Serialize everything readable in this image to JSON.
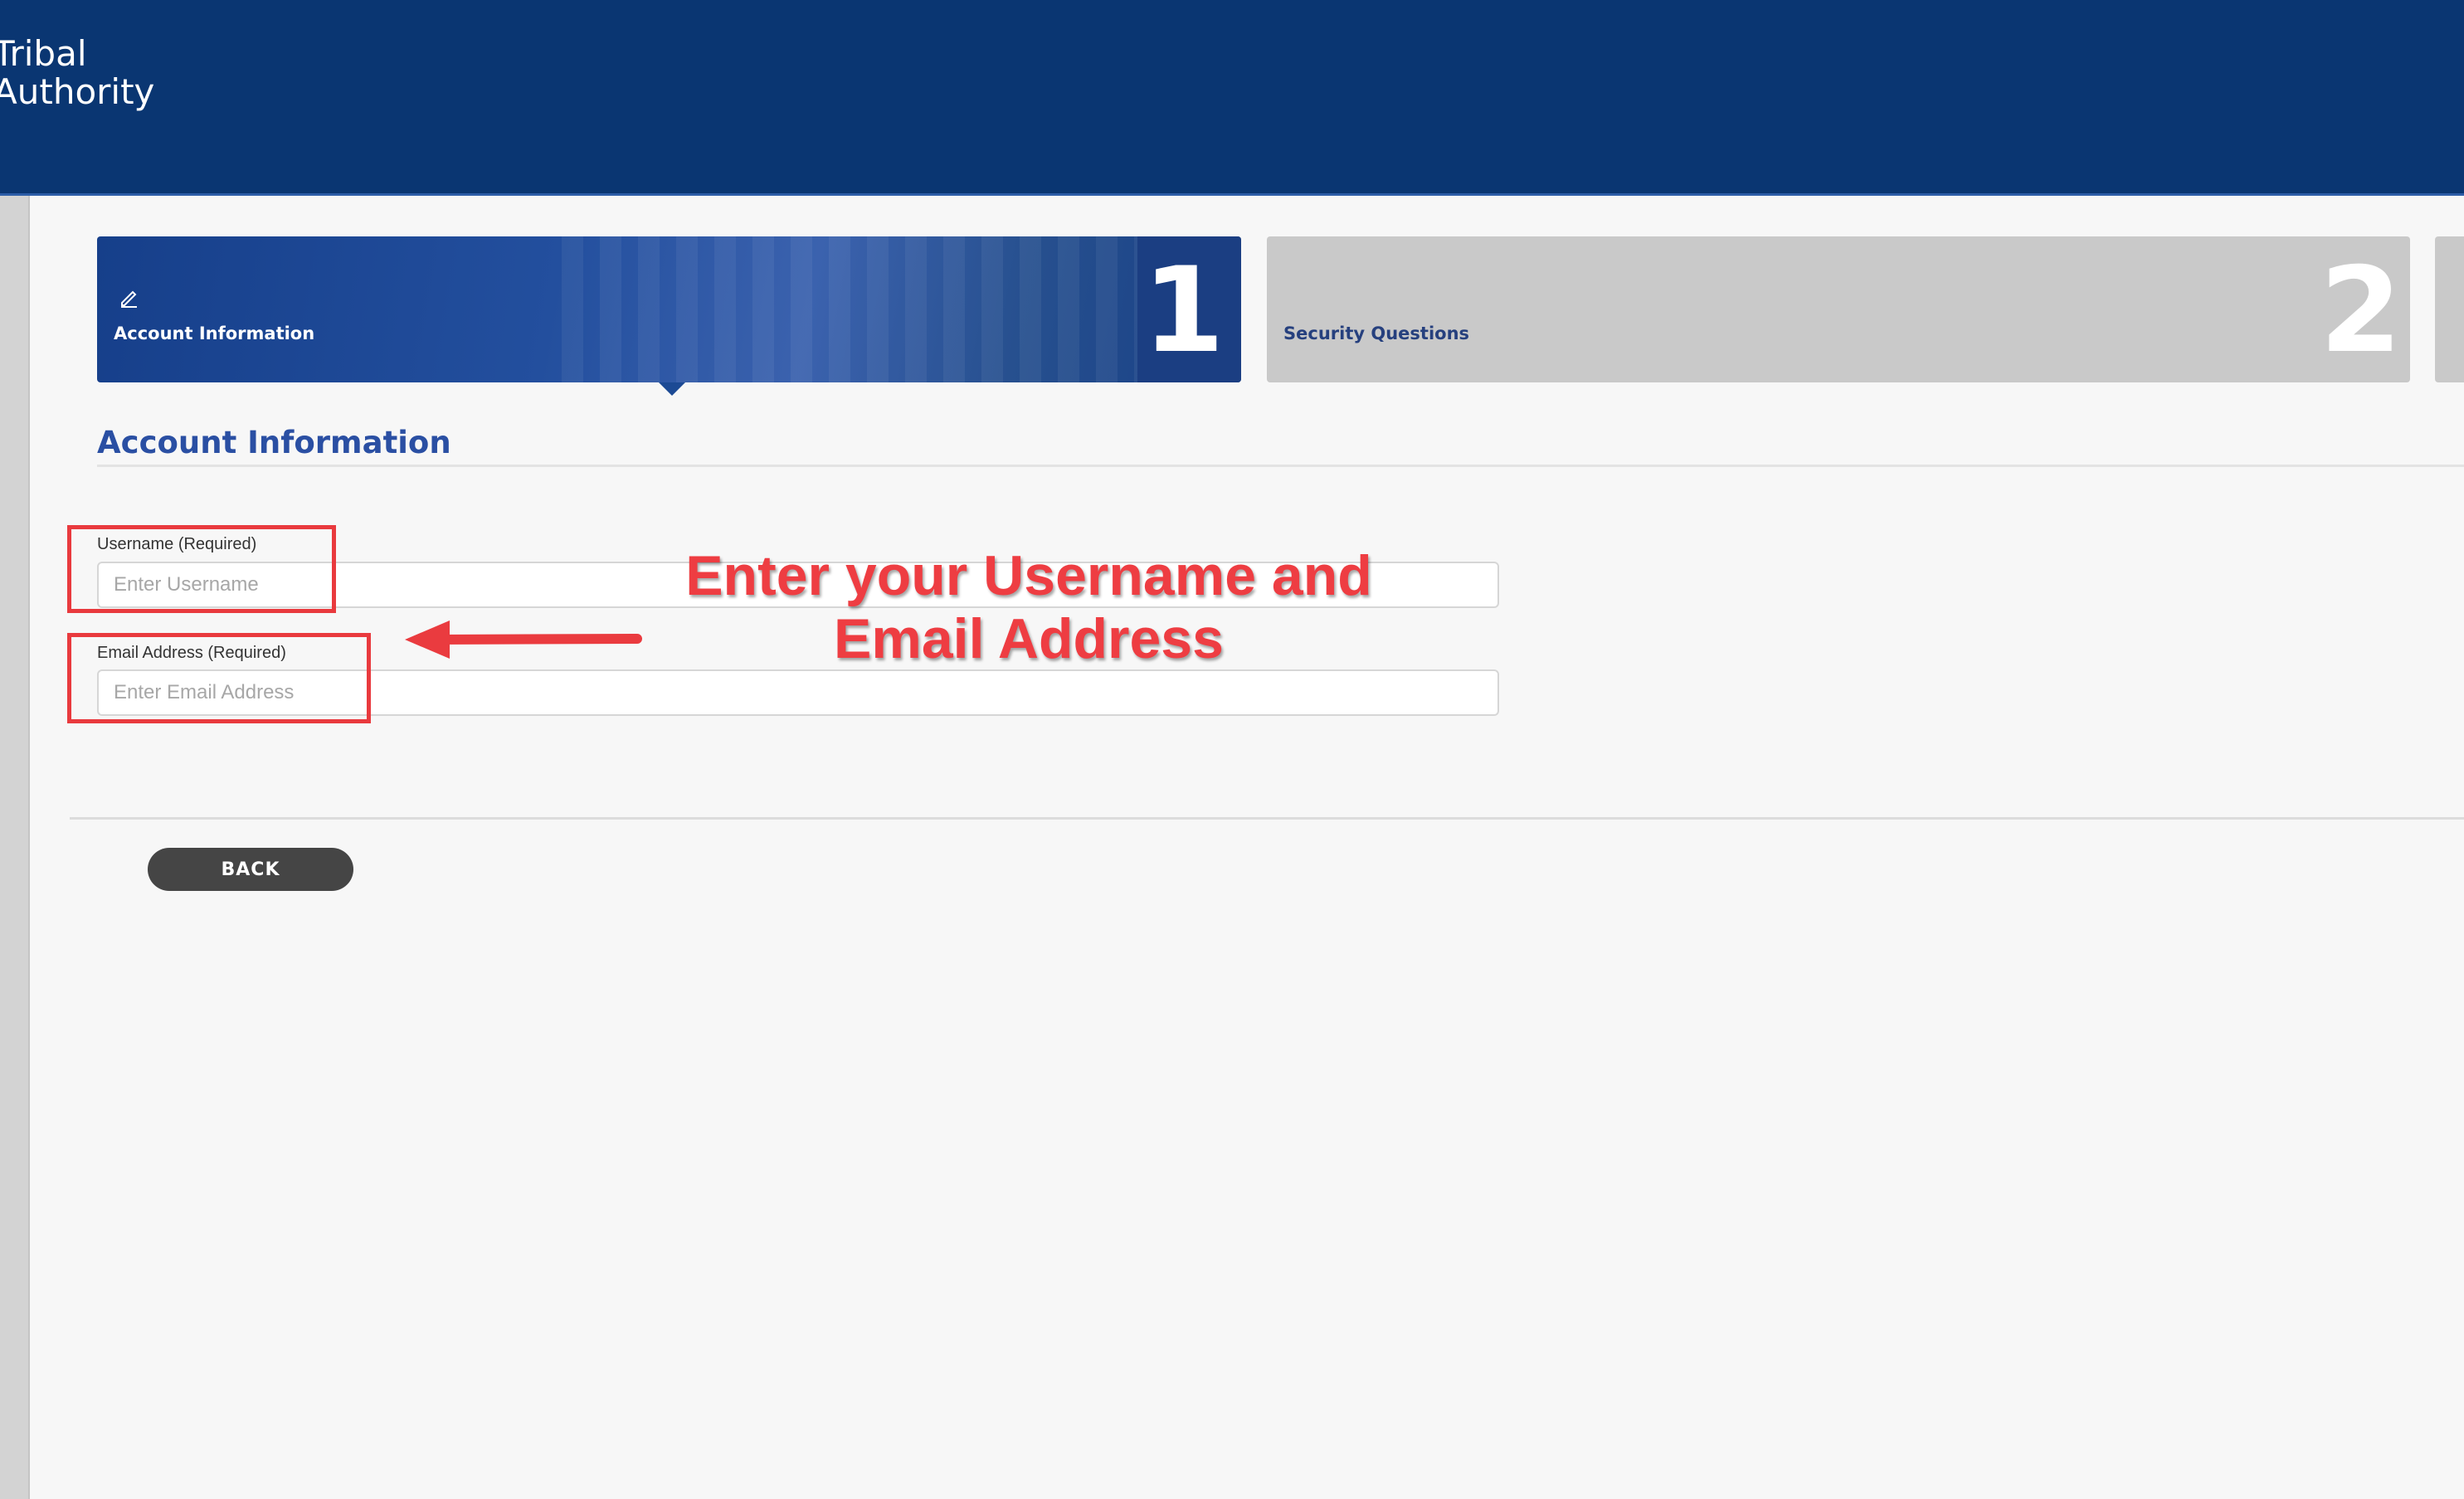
{
  "header": {
    "brand_line1": "Tribal",
    "brand_line2": "Authority"
  },
  "steps": [
    {
      "number": "1",
      "label": "Account Information",
      "active": true
    },
    {
      "number": "2",
      "label": "Security Questions",
      "active": false
    }
  ],
  "section": {
    "title": "Account Information"
  },
  "form": {
    "username": {
      "label": "Username (Required)",
      "placeholder": "Enter Username",
      "value": ""
    },
    "email": {
      "label": "Email Address (Required)",
      "placeholder": "Enter Email Address",
      "value": ""
    }
  },
  "annotation": {
    "line1": "Enter your Username and",
    "line2": "Email Address",
    "color": "#ee3d42"
  },
  "buttons": {
    "back_label": "BACK"
  },
  "colors": {
    "header_bg": "#0a3672",
    "active_step": "#1c4a94",
    "inactive_step": "#c9c9c9",
    "highlight": "#e93a3e"
  },
  "icons": {
    "step1_icon": "edit-icon",
    "annotation_arrow": "arrow-left-icon"
  }
}
